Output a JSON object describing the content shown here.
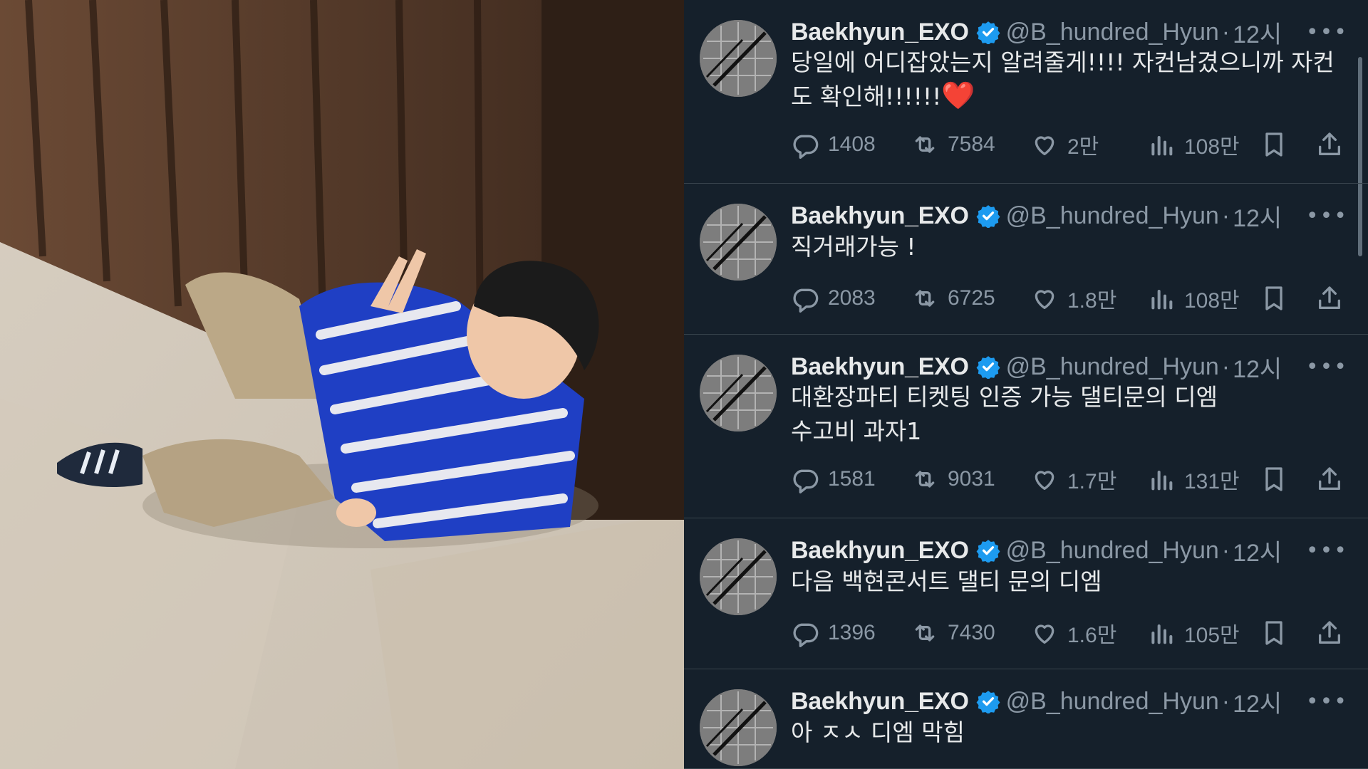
{
  "tweets": [
    {
      "name": "Baekhyun_EXO",
      "handle": "@B_hundred_Hyun",
      "dot": "·",
      "time": "12시",
      "text": "당일에 어디잡았는지 알려줄게!!!! 자컨남겼으니까 자컨\n도 확인해!!!!!!",
      "emoji": "❤️",
      "replies": "1408",
      "retweets": "7584",
      "likes": "2만",
      "views": "108만"
    },
    {
      "name": "Baekhyun_EXO",
      "handle": "@B_hundred_Hyun",
      "dot": "·",
      "time": "12시",
      "text": "직거래가능 !",
      "emoji": "",
      "replies": "2083",
      "retweets": "6725",
      "likes": "1.8만",
      "views": "108만"
    },
    {
      "name": "Baekhyun_EXO",
      "handle": "@B_hundred_Hyun",
      "dot": "·",
      "time": "12시",
      "text": "대환장파티 티켓팅 인증 가능 댈티문의 디엠\n수고비 과자1",
      "emoji": "",
      "replies": "1581",
      "retweets": "9031",
      "likes": "1.7만",
      "views": "131만"
    },
    {
      "name": "Baekhyun_EXO",
      "handle": "@B_hundred_Hyun",
      "dot": "·",
      "time": "12시",
      "text": "다음 백현콘서트 댈티 문의 디엠",
      "emoji": "",
      "replies": "1396",
      "retweets": "7430",
      "likes": "1.6만",
      "views": "105만"
    },
    {
      "name": "Baekhyun_EXO",
      "handle": "@B_hundred_Hyun",
      "dot": "·",
      "time": "12시",
      "text": "아 ㅈㅅ 디엠 막힘",
      "emoji": ""
    }
  ],
  "icons": {
    "reply": "reply-icon",
    "retweet": "retweet-icon",
    "like": "heart-icon",
    "views": "views-icon",
    "bookmark": "bookmark-icon",
    "share": "share-icon",
    "more": "more-icon",
    "verified": "verified-badge-icon"
  },
  "colors": {
    "background": "#15202b",
    "text": "#e7e9ea",
    "muted": "#8b98a5",
    "verified": "#1d9bf0",
    "divider": "#38444d",
    "sweater_blue": "#1f3fc4"
  }
}
